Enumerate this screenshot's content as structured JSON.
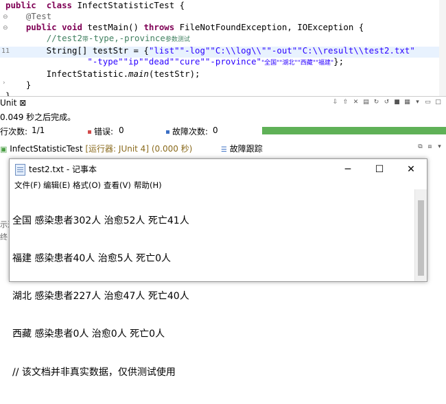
{
  "editor": {
    "lines": [
      {
        "parts": [
          [
            "kw",
            "public"
          ],
          [
            "",
            "  "
          ],
          [
            "kw",
            "class"
          ],
          [
            "",
            " InfectStatisticTest {"
          ]
        ]
      },
      {
        "parts": [
          [
            "",
            "    "
          ],
          [
            "ann",
            "@Test"
          ]
        ]
      },
      {
        "parts": [
          [
            "",
            "    "
          ],
          [
            "kw",
            "public"
          ],
          [
            "",
            " "
          ],
          [
            "kw",
            "void"
          ],
          [
            "",
            " testMain() "
          ],
          [
            "kw",
            "throws"
          ],
          [
            "",
            " FileNotFoundException, IOException {"
          ]
        ]
      },
      {
        "parts": [
          [
            "",
            "        "
          ],
          [
            "cm",
            "//test2"
          ],
          [
            "cm cn",
            "带"
          ],
          [
            "cm",
            "-type,-province"
          ],
          [
            "cm cn",
            "参数测试"
          ]
        ]
      },
      {
        "parts": [
          [
            "",
            "        String[] testStr = {"
          ],
          [
            "st",
            "\"list\""
          ],
          [
            ", "
          ],
          [
            "st",
            "\"-log\""
          ],
          [
            ", "
          ],
          [
            "st",
            "\"C:\\\\log\\\\\""
          ],
          [
            ", "
          ],
          [
            "st",
            "\"-out\""
          ],
          [
            ", "
          ],
          [
            "st",
            "\"C:\\\\result\\\\test2.txt\""
          ],
          [
            ","
          ]
        ]
      },
      {
        "parts": [
          [
            "",
            "                "
          ],
          [
            "st",
            "\"-type\""
          ],
          [
            ", "
          ],
          [
            "st",
            "\"ip\""
          ],
          [
            ", "
          ],
          [
            "st",
            "\"dead\""
          ],
          [
            ", "
          ],
          [
            "st",
            "\"cure\""
          ],
          [
            ", "
          ],
          [
            "st",
            "\"-province\""
          ],
          [
            ", "
          ],
          [
            "st cn",
            "\"全国\""
          ],
          [
            ", "
          ],
          [
            "st cn",
            "\"湖北\""
          ],
          [
            ", "
          ],
          [
            "st cn",
            "\"西藏\""
          ],
          [
            ", "
          ],
          [
            "st cn",
            "\"福建\""
          ],
          [
            "",
            "};"
          ]
        ]
      },
      {
        "parts": [
          [
            "",
            "        InfectStatistic."
          ],
          [
            "it",
            "main"
          ],
          [
            "",
            "(testStr);"
          ]
        ]
      },
      {
        "parts": [
          [
            "",
            "    }"
          ]
        ]
      },
      {
        "parts": [
          [
            "",
            "}"
          ]
        ]
      }
    ],
    "line_numbers": [
      "11"
    ]
  },
  "junit": {
    "tab_title": "Unit ⊠",
    "status": "0.049 秒之后完成。",
    "runs_label": "行次数:",
    "runs_value": "1/1",
    "errors_label": "错误:",
    "errors_value": "0",
    "failures_label": "故障次数:",
    "failures_value": "0",
    "progress": 1.0,
    "test_name": "InfectStatisticTest",
    "runner": "[运行器: JUnit 4]",
    "time": "(0.000 秒)",
    "failure_trace": "故障跟踪",
    "frag1": "示迟",
    "frag2": "终"
  },
  "notepad": {
    "title": "test2.txt - 记事本",
    "minimize": "─",
    "maximize": "☐",
    "close": "✕",
    "menu": [
      "文件(F)",
      "编辑(E)",
      "格式(O)",
      "查看(V)",
      "帮助(H)"
    ],
    "content": [
      "全国 感染患者302人 治愈52人 死亡41人",
      "福建 感染患者40人 治愈5人 死亡0人",
      "湖北 感染患者227人 治愈47人 死亡40人",
      "西藏 感染患者0人 治愈0人 死亡0人",
      "// 该文档并非真实数据，仅供测试使用"
    ]
  },
  "colors": {
    "keyword": "#7f0055",
    "string": "#2a00ff",
    "comment": "#3f7f5f",
    "progress": "#5fb157"
  }
}
